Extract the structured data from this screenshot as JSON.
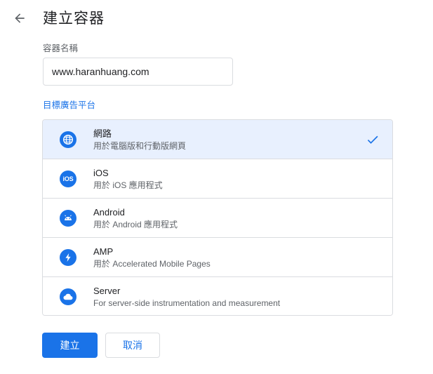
{
  "header": {
    "back_icon": "arrow-back-icon",
    "title": "建立容器"
  },
  "form": {
    "name_label": "容器名稱",
    "name_value": "www.haranhuang.com",
    "platform_label": "目標廣告平台"
  },
  "platforms": [
    {
      "icon": "globe-icon",
      "title": "網路",
      "desc": "用於電腦版和行動版網頁",
      "selected": true
    },
    {
      "icon": "ios-icon",
      "icon_text": "iOS",
      "title": "iOS",
      "desc": "用於 iOS 應用程式",
      "selected": false
    },
    {
      "icon": "android-icon",
      "title": "Android",
      "desc": "用於 Android 應用程式",
      "selected": false
    },
    {
      "icon": "amp-bolt-icon",
      "title": "AMP",
      "desc": "用於 Accelerated Mobile Pages",
      "selected": false
    },
    {
      "icon": "cloud-icon",
      "title": "Server",
      "desc": "For server-side instrumentation and measurement",
      "selected": false
    }
  ],
  "selected_check_icon": "check-icon",
  "buttons": {
    "create_label": "建立",
    "cancel_label": "取消"
  },
  "colors": {
    "accent": "#1a73e8",
    "selected_bg": "#e8f0fe",
    "border": "#dadce0",
    "text_secondary": "#5f6368"
  }
}
